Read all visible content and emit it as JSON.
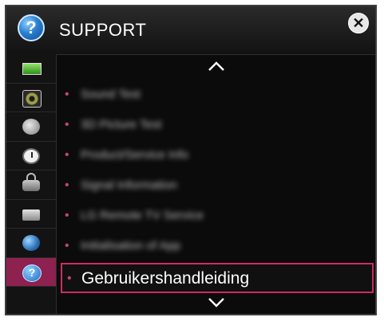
{
  "header": {
    "title": "SUPPORT",
    "help_glyph": "?",
    "close_glyph": "✕"
  },
  "sidebar": {
    "items": [
      {
        "icon": "tv-picture-icon",
        "active": false
      },
      {
        "icon": "speaker-icon",
        "active": false
      },
      {
        "icon": "satellite-dish-icon",
        "active": false
      },
      {
        "icon": "clock-icon",
        "active": false
      },
      {
        "icon": "lock-icon",
        "active": false
      },
      {
        "icon": "toolbox-icon",
        "active": false
      },
      {
        "icon": "globe-network-icon",
        "active": false
      },
      {
        "icon": "help-icon",
        "active": true,
        "glyph": "?"
      }
    ]
  },
  "menu": {
    "scroll_up_glyph": "^",
    "scroll_down_glyph": "⌄",
    "bullet": "•",
    "items": [
      {
        "label": "Sound Test",
        "blurred": true
      },
      {
        "label": "3D Picture Test",
        "blurred": true
      },
      {
        "label": "Product/Service Info",
        "blurred": true
      },
      {
        "label": "Signal Information",
        "blurred": true
      },
      {
        "label": "LG Remote TV Service",
        "blurred": true
      },
      {
        "label": "Initialisation of App",
        "blurred": true
      },
      {
        "label": "Gebruikershandleiding",
        "selected": true
      }
    ]
  },
  "colors": {
    "accent": "#d12a5e",
    "active_sidebar": "#8d2150",
    "background": "#0b0b0b"
  }
}
